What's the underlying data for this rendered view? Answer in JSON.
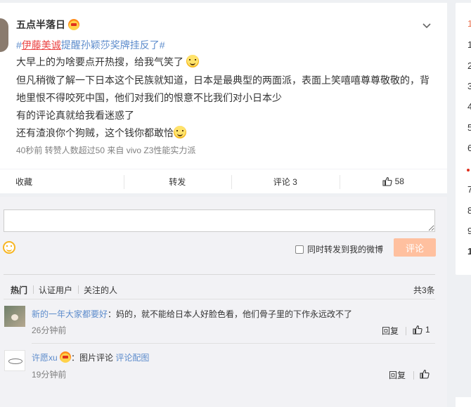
{
  "post": {
    "username": "五点半落日",
    "topic_prefix": "#",
    "topic_highlight": "伊藤美诚",
    "topic_link": "提醒孙颖莎奖牌挂反了",
    "topic_suffix": "#",
    "lines": [
      "大早上的为啥要点开热搜，给我气笑了",
      "但凡稍微了解一下日本这个民族就知道，日本是最典型的两面派，表面上笑嘻嘻尊尊敬敬的，背",
      "地里恨不得咬死中国，他们对我们的恨意不比我们对小日本少",
      "有的评论真就给我看迷惑了",
      "还有渣浪你个狗贼，这个钱你都敢恰"
    ],
    "meta": "40秒前 转赞人数超过50  来自 vivo Z3性能实力派"
  },
  "actions": {
    "favorite": "收藏",
    "repost": "转发",
    "comment": "评论 3",
    "like_count": "58"
  },
  "compose": {
    "repost_checkbox_label": "同时转发到我的微博",
    "submit_label": "评论"
  },
  "filters": {
    "tabs": [
      "热门",
      "认证用户",
      "关注的人"
    ],
    "total": "共3条"
  },
  "comments": [
    {
      "name": "新的一年大家都要好",
      "text": "：妈的，就不能给日本人好脸色看，他们骨子里的下作永远改不了",
      "time": "26分钟前",
      "reply": "回复",
      "likes": "1"
    },
    {
      "name": "许愿xu",
      "text": "：图片评论 ",
      "link": "评论配图",
      "time": "19分钟前",
      "reply": "回复",
      "likes": ""
    }
  ],
  "right_panel": {
    "numbers": [
      "1",
      "1",
      "2",
      "3",
      "4",
      "5",
      "6",
      "7",
      "8",
      "9",
      "1"
    ]
  },
  "colors": {
    "accent": "#eb7350",
    "link": "#5d8ccc",
    "button_disabled": "#ffc09f"
  }
}
